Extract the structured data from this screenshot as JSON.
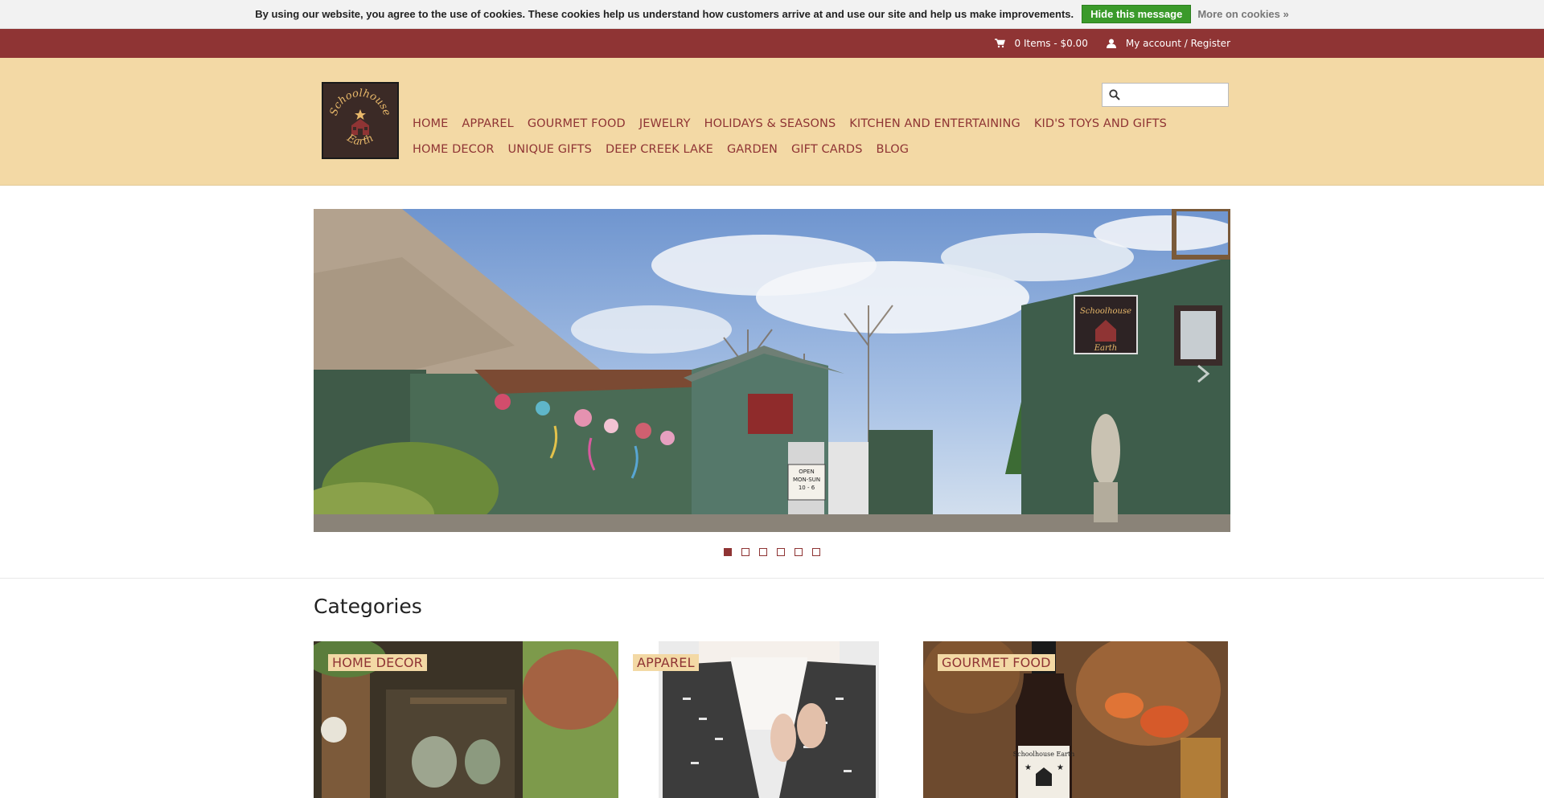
{
  "cookie": {
    "text": "By using our website, you agree to the use of cookies. These cookies help us understand how customers arrive at and use our site and help us make improvements.",
    "hide_label": "Hide this message",
    "more_label": "More on cookies »"
  },
  "topbar": {
    "cart_label": "0 Items - $0.00",
    "account_label": "My account / Register",
    "cart_icon": "cart-icon",
    "account_icon": "user-icon"
  },
  "header": {
    "logo_line1": "Schoolhouse",
    "logo_line2": "Earth",
    "search_placeholder": "",
    "search_icon": "search-icon"
  },
  "nav": {
    "items": [
      "HOME",
      "APPAREL",
      "GOURMET FOOD",
      "JEWELRY",
      "HOLIDAYS & SEASONS",
      "KITCHEN AND ENTERTAINING",
      "KID'S TOYS AND GIFTS",
      "HOME DECOR",
      "UNIQUE GIFTS",
      "DEEP CREEK LAKE",
      "GARDEN",
      "GIFT CARDS",
      "BLOG"
    ]
  },
  "slider": {
    "sign_line1": "Schoolhouse",
    "sign_line2": "Earth",
    "open_sign_l1": "OPEN",
    "open_sign_l2": "MON-SUN",
    "open_sign_l3": "10 - 6",
    "slide_count": 6,
    "active_index": 1
  },
  "categories": {
    "title": "Categories",
    "items": [
      {
        "label": "HOME DECOR"
      },
      {
        "label": "APPAREL"
      },
      {
        "label": "GOURMET FOOD"
      }
    ],
    "bottle_label": "Schoolhouse Earth"
  },
  "colors": {
    "brand": "#8f3434",
    "header_bg": "#f3d9a5",
    "accept_green": "#3a9a2a"
  }
}
